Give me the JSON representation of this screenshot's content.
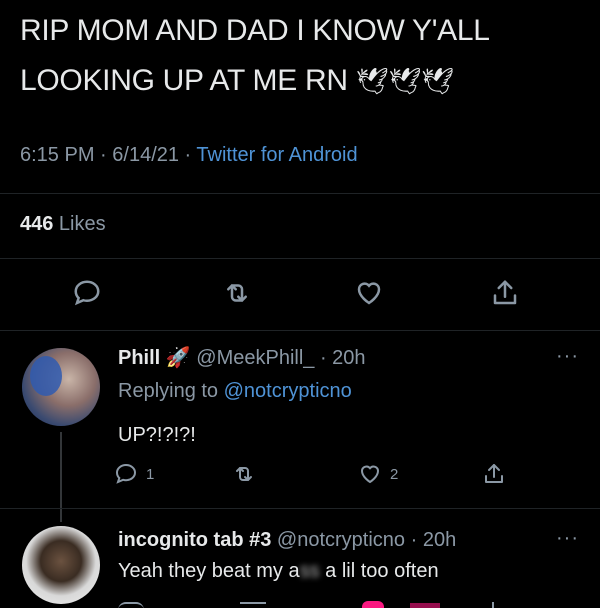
{
  "tweet": {
    "text_line1": "RIP MOM AND DAD I KNOW Y'ALL",
    "text_line2": "LOOKING UP AT ME RN",
    "emoji": "🕊🕊🕊",
    "time": "6:15 PM",
    "separator1": " · ",
    "date": "6/14/21",
    "separator2": " · ",
    "source": "Twitter for Android",
    "likes_count": "446",
    "likes_label": " Likes",
    "actions": [
      "reply-icon",
      "retweet-icon",
      "like-icon",
      "share-icon"
    ]
  },
  "replies": [
    {
      "name": "Phill",
      "badge": "🚀",
      "handle": "@MeekPhill_",
      "time_sep": " · ",
      "time": "20h",
      "replying_prefix": "Replying to ",
      "replying_to": "@notcrypticno",
      "text": "UP?!?!?!",
      "reply_count": "1",
      "like_count": "2",
      "more": "···"
    },
    {
      "name": "incognito tab #3",
      "handle": "@notcrypticno",
      "time_sep": " · ",
      "time": "20h",
      "text_before": "Yeah they beat my a",
      "text_blur": "ss",
      "text_after": " a lil too often",
      "more": "···"
    }
  ],
  "colors": {
    "background": "#000000",
    "text": "#e7e9ea",
    "secondary": "#8b98a5",
    "link": "#4f93d6"
  }
}
